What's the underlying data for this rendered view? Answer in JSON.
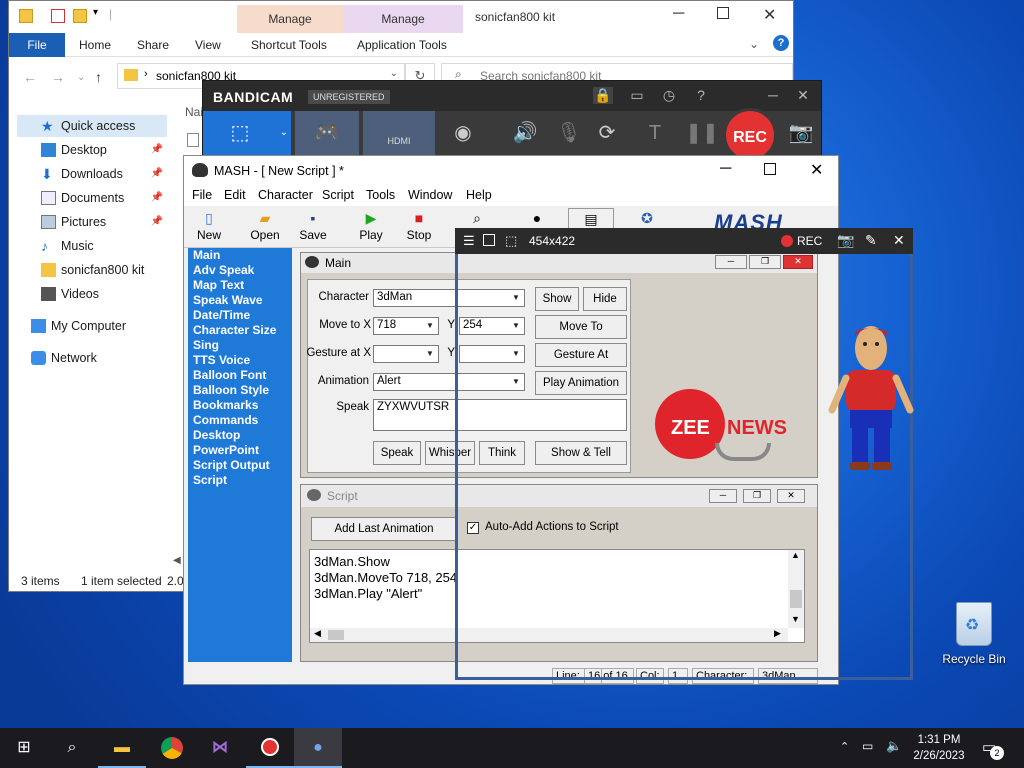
{
  "explorer": {
    "title": "sonicfan800 kit",
    "file_tab": "File",
    "tabs": [
      "Home",
      "Share",
      "View"
    ],
    "manage1": "Manage",
    "manage1_sub": "Shortcut Tools",
    "manage2": "Manage",
    "manage2_sub": "Application Tools",
    "address": "sonicfan800 kit",
    "search_placeholder": "Search sonicfan800 kit",
    "column_name": "Nai",
    "nav": [
      {
        "label": "Quick access"
      },
      {
        "label": "Desktop"
      },
      {
        "label": "Downloads"
      },
      {
        "label": "Documents"
      },
      {
        "label": "Pictures"
      },
      {
        "label": "Music"
      },
      {
        "label": "sonicfan800 kit"
      },
      {
        "label": "Videos"
      },
      {
        "label": "My Computer"
      },
      {
        "label": "Network"
      }
    ],
    "status_items": "3 items",
    "status_selected": "1 item selected",
    "status_size": "2.0"
  },
  "bandicam": {
    "logo": "BANDICAM",
    "unregistered": "UNREGISTERED",
    "hdmi": "HDMI",
    "rec": "REC"
  },
  "mash": {
    "title": "MASH - [ New Script ] *",
    "menu": [
      "File",
      "Edit",
      "Character",
      "Script",
      "Tools",
      "Window",
      "Help"
    ],
    "toolbar": [
      "New",
      "Open",
      "Save",
      "Play",
      "Stop"
    ],
    "logo": "MASH",
    "sidebar": [
      "Main",
      "Adv Speak",
      "Map Text",
      "Speak Wave",
      "Date/Time",
      "Character Size",
      "Sing",
      "TTS Voice",
      "Balloon Font",
      "Balloon Style",
      "Bookmarks",
      "Commands",
      "Desktop",
      "PowerPoint",
      "Script Output",
      "Script"
    ],
    "main": {
      "title": "Main",
      "character_label": "Character",
      "character_value": "3dMan",
      "moveto_label": "Move to X",
      "x_value": "718",
      "y_label": "Y",
      "y_value": "254",
      "gesture_label": "Gesture at X",
      "gesture_y_label": "Y",
      "animation_label": "Animation",
      "animation_value": "Alert",
      "speak_label": "Speak",
      "speak_value": "ZYXWVUTSR",
      "btn_show": "Show",
      "btn_hide": "Hide",
      "btn_moveto": "Move To",
      "btn_gesture": "Gesture At",
      "btn_play_anim": "Play Animation",
      "btn_speak": "Speak",
      "btn_whisper": "Whisper",
      "btn_think": "Think",
      "btn_showtell": "Show & Tell",
      "zee": "ZEE",
      "news": "NEWS"
    },
    "script": {
      "title": "Script",
      "add_last": "Add Last Animation",
      "auto_add": "Auto-Add Actions to Script",
      "lines": [
        "3dMan.Show",
        "3dMan.MoveTo 718, 254",
        "3dMan.Play \"Alert\""
      ]
    },
    "status": {
      "line_label": "Line:",
      "line_value": "16 of 16",
      "col_label": "Col:",
      "col_value": "1",
      "char_label": "Character:",
      "char_value": "3dMan"
    }
  },
  "capture": {
    "size": "454x422",
    "rec": "REC"
  },
  "desktop": {
    "recycle_bin": "Recycle Bin"
  },
  "taskbar": {
    "time": "1:31 PM",
    "date": "2/26/2023",
    "notifications": "2"
  }
}
